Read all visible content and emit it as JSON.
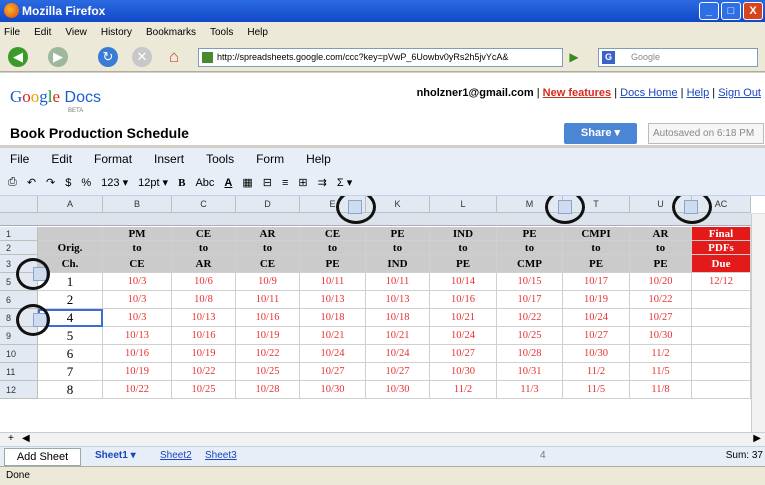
{
  "window": {
    "title": "Mozilla Firefox",
    "min": "_",
    "max": "□",
    "close": "X"
  },
  "menu": [
    "File",
    "Edit",
    "View",
    "History",
    "Bookmarks",
    "Tools",
    "Help"
  ],
  "nav": {
    "url": "http://spreadsheets.google.com/ccc?key=pVwP_6Uowbv0yRs2h5jvYcA&",
    "search_placeholder": "Google",
    "search_engine_icon": "G"
  },
  "docs": {
    "logo_google": [
      "G",
      "o",
      "o",
      "g",
      "l",
      "e"
    ],
    "logo_docs": " Docs",
    "beta": "BETA",
    "email": "nholzner1@gmail.com",
    "sep": " | ",
    "links": [
      "New features",
      "Docs Home",
      "Help",
      "Sign Out"
    ],
    "title": "Book Production Schedule",
    "share": "Share ▾",
    "autosave": "Autosaved on 6:18 PM"
  },
  "appmenu": [
    "File",
    "Edit",
    "Format",
    "Insert",
    "Tools",
    "Form",
    "Help"
  ],
  "toolbar": {
    "currency": "$",
    "percent": "%",
    "numfmt": "123 ▾",
    "fontsize": "12pt ▾",
    "bold": "B",
    "strike": "Abc",
    "textcolor": "A",
    "sum": "Σ ▾"
  },
  "grid": {
    "columns": [
      "A",
      "B",
      "C",
      "D",
      "E",
      "K",
      "L",
      "M",
      "T",
      "U",
      "AC"
    ],
    "header_rows": [
      {
        "row": "1",
        "cells": [
          "",
          "PM",
          "CE",
          "AR",
          "CE",
          "PE",
          "IND",
          "PE",
          "CMPI",
          "AR",
          "Final"
        ]
      },
      {
        "row": "2",
        "cells": [
          "Orig.",
          "to",
          "to",
          "to",
          "to",
          "to",
          "to",
          "to",
          "to",
          "to",
          "PDFs"
        ]
      },
      {
        "row": "3",
        "cells": [
          "Ch.",
          "CE",
          "AR",
          "CE",
          "PE",
          "IND",
          "PE",
          "CMP",
          "PE",
          "PE",
          "Due"
        ]
      }
    ],
    "data_rows": [
      {
        "row": "5",
        "cells": [
          "1",
          "10/3",
          "10/6",
          "10/9",
          "10/11",
          "10/11",
          "10/14",
          "10/15",
          "10/17",
          "10/20",
          "12/12"
        ]
      },
      {
        "row": "6",
        "cells": [
          "2",
          "10/3",
          "10/8",
          "10/11",
          "10/13",
          "10/13",
          "10/16",
          "10/17",
          "10/19",
          "10/22",
          ""
        ]
      },
      {
        "row": "8",
        "cells": [
          "4",
          "10/3",
          "10/13",
          "10/16",
          "10/18",
          "10/18",
          "10/21",
          "10/22",
          "10/24",
          "10/27",
          ""
        ]
      },
      {
        "row": "9",
        "cells": [
          "5",
          "10/13",
          "10/16",
          "10/19",
          "10/21",
          "10/21",
          "10/24",
          "10/25",
          "10/27",
          "10/30",
          ""
        ]
      },
      {
        "row": "10",
        "cells": [
          "6",
          "10/16",
          "10/19",
          "10/22",
          "10/24",
          "10/24",
          "10/27",
          "10/28",
          "10/30",
          "11/2",
          ""
        ]
      },
      {
        "row": "11",
        "cells": [
          "7",
          "10/19",
          "10/22",
          "10/25",
          "10/27",
          "10/27",
          "10/30",
          "10/31",
          "11/2",
          "11/5",
          ""
        ]
      },
      {
        "row": "12",
        "cells": [
          "8",
          "10/22",
          "10/25",
          "10/28",
          "10/30",
          "10/30",
          "11/2",
          "11/3",
          "11/5",
          "11/8",
          ""
        ]
      }
    ]
  },
  "sheets": {
    "add": "Add Sheet",
    "tabs": [
      "Sheet1 ▾",
      "Sheet2",
      "Sheet3"
    ],
    "count": "4",
    "sum": "Sum: 37"
  },
  "status": "Done",
  "colors": {
    "date": "#e53030",
    "final": "#e21a1a",
    "header_gray": "#cbcbcb",
    "accent": "#4a86d4"
  }
}
